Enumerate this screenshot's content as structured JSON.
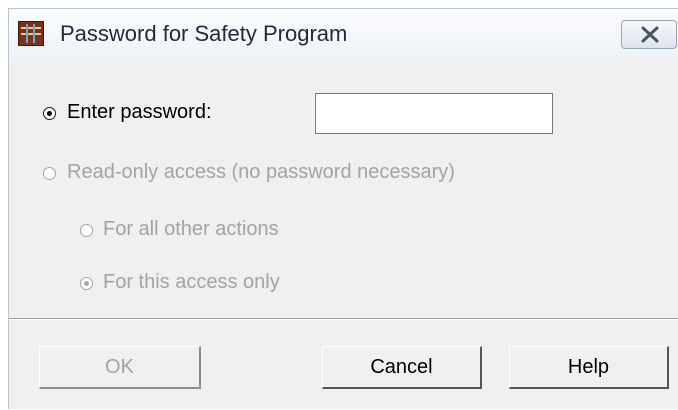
{
  "window": {
    "title": "Password for Safety Program",
    "app_icon": "safety-program-app-icon",
    "close_icon": "close-x-icon"
  },
  "options": {
    "enter_password": {
      "label": "Enter password:",
      "selected": true,
      "enabled": true
    },
    "read_only": {
      "label": "Read-only access (no password necessary)",
      "selected": false,
      "enabled": false
    },
    "all_actions": {
      "label": "For all other actions",
      "selected": false,
      "enabled": false
    },
    "this_access": {
      "label": "For this access only",
      "selected": true,
      "enabled": false
    }
  },
  "password_field": {
    "value": "",
    "placeholder": ""
  },
  "buttons": {
    "ok": "OK",
    "cancel": "Cancel",
    "help": "Help"
  }
}
